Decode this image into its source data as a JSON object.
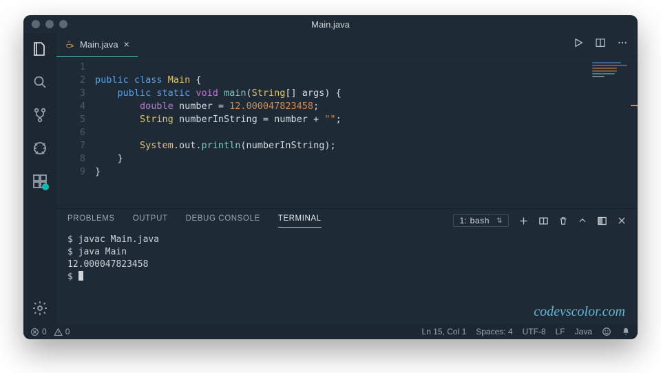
{
  "window": {
    "title": "Main.java"
  },
  "tab": {
    "filename": "Main.java"
  },
  "editor": {
    "line_numbers": [
      "1",
      "2",
      "3",
      "4",
      "5",
      "6",
      "7",
      "8",
      "9"
    ],
    "tokens": [
      [],
      [
        {
          "t": "public ",
          "c": "kw1"
        },
        {
          "t": "class ",
          "c": "kw1"
        },
        {
          "t": "Main ",
          "c": "cls"
        },
        {
          "t": "{",
          "c": "pn"
        }
      ],
      [
        {
          "t": "    ",
          "c": "pn"
        },
        {
          "t": "public ",
          "c": "kw1"
        },
        {
          "t": "static ",
          "c": "kw1"
        },
        {
          "t": "void ",
          "c": "kw2"
        },
        {
          "t": "main",
          "c": "mth"
        },
        {
          "t": "(",
          "c": "pn"
        },
        {
          "t": "String",
          "c": "cls"
        },
        {
          "t": "[] ",
          "c": "pn"
        },
        {
          "t": "args",
          "c": "id"
        },
        {
          "t": ") {",
          "c": "pn"
        }
      ],
      [
        {
          "t": "        ",
          "c": "pn"
        },
        {
          "t": "double ",
          "c": "kw2"
        },
        {
          "t": "number ",
          "c": "id"
        },
        {
          "t": "= ",
          "c": "pn"
        },
        {
          "t": "12.000047823458",
          "c": "num"
        },
        {
          "t": ";",
          "c": "pn"
        }
      ],
      [
        {
          "t": "        ",
          "c": "pn"
        },
        {
          "t": "String ",
          "c": "cls"
        },
        {
          "t": "numberInString ",
          "c": "id"
        },
        {
          "t": "= ",
          "c": "pn"
        },
        {
          "t": "number ",
          "c": "id"
        },
        {
          "t": "+ ",
          "c": "pn"
        },
        {
          "t": "\"\"",
          "c": "str"
        },
        {
          "t": ";",
          "c": "pn"
        }
      ],
      [],
      [
        {
          "t": "        ",
          "c": "pn"
        },
        {
          "t": "System",
          "c": "cls"
        },
        {
          "t": ".",
          "c": "pn"
        },
        {
          "t": "out",
          "c": "id"
        },
        {
          "t": ".",
          "c": "pn"
        },
        {
          "t": "println",
          "c": "mth"
        },
        {
          "t": "(",
          "c": "pn"
        },
        {
          "t": "numberInString",
          "c": "id"
        },
        {
          "t": ");",
          "c": "pn"
        }
      ],
      [
        {
          "t": "    }",
          "c": "pn"
        }
      ],
      [
        {
          "t": "}",
          "c": "pn"
        }
      ]
    ]
  },
  "panel": {
    "tabs": {
      "problems": "PROBLEMS",
      "output": "OUTPUT",
      "debug": "DEBUG CONSOLE",
      "terminal": "TERMINAL"
    },
    "terminal_selector": "1: bash",
    "terminal_lines": [
      "$ javac Main.java",
      "$ java Main",
      "12.000047823458",
      "$ "
    ]
  },
  "watermark": "codevscolor.com",
  "status": {
    "errors": "0",
    "warnings": "0",
    "position": "Ln 15, Col 1",
    "spaces": "Spaces: 4",
    "encoding": "UTF-8",
    "eol": "LF",
    "language": "Java"
  }
}
